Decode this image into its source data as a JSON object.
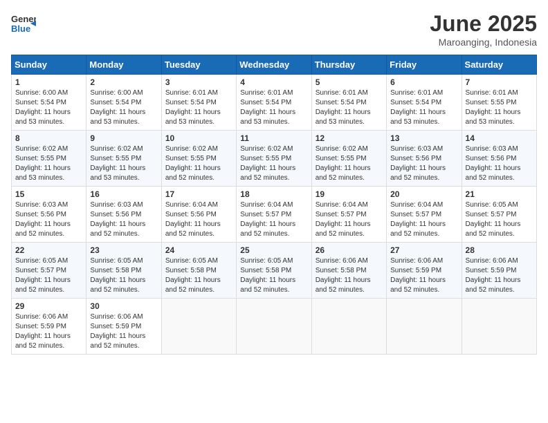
{
  "header": {
    "logo_general": "General",
    "logo_blue": "Blue",
    "title": "June 2025",
    "subtitle": "Maroanging, Indonesia"
  },
  "calendar": {
    "days_of_week": [
      "Sunday",
      "Monday",
      "Tuesday",
      "Wednesday",
      "Thursday",
      "Friday",
      "Saturday"
    ],
    "weeks": [
      [
        null,
        null,
        null,
        null,
        null,
        null,
        null
      ]
    ],
    "cells": [
      {
        "day": 1,
        "sunrise": "6:00 AM",
        "sunset": "5:54 PM",
        "daylight": "11 hours and 53 minutes."
      },
      {
        "day": 2,
        "sunrise": "6:00 AM",
        "sunset": "5:54 PM",
        "daylight": "11 hours and 53 minutes."
      },
      {
        "day": 3,
        "sunrise": "6:01 AM",
        "sunset": "5:54 PM",
        "daylight": "11 hours and 53 minutes."
      },
      {
        "day": 4,
        "sunrise": "6:01 AM",
        "sunset": "5:54 PM",
        "daylight": "11 hours and 53 minutes."
      },
      {
        "day": 5,
        "sunrise": "6:01 AM",
        "sunset": "5:54 PM",
        "daylight": "11 hours and 53 minutes."
      },
      {
        "day": 6,
        "sunrise": "6:01 AM",
        "sunset": "5:54 PM",
        "daylight": "11 hours and 53 minutes."
      },
      {
        "day": 7,
        "sunrise": "6:01 AM",
        "sunset": "5:55 PM",
        "daylight": "11 hours and 53 minutes."
      },
      {
        "day": 8,
        "sunrise": "6:02 AM",
        "sunset": "5:55 PM",
        "daylight": "11 hours and 53 minutes."
      },
      {
        "day": 9,
        "sunrise": "6:02 AM",
        "sunset": "5:55 PM",
        "daylight": "11 hours and 53 minutes."
      },
      {
        "day": 10,
        "sunrise": "6:02 AM",
        "sunset": "5:55 PM",
        "daylight": "11 hours and 52 minutes."
      },
      {
        "day": 11,
        "sunrise": "6:02 AM",
        "sunset": "5:55 PM",
        "daylight": "11 hours and 52 minutes."
      },
      {
        "day": 12,
        "sunrise": "6:02 AM",
        "sunset": "5:55 PM",
        "daylight": "11 hours and 52 minutes."
      },
      {
        "day": 13,
        "sunrise": "6:03 AM",
        "sunset": "5:56 PM",
        "daylight": "11 hours and 52 minutes."
      },
      {
        "day": 14,
        "sunrise": "6:03 AM",
        "sunset": "5:56 PM",
        "daylight": "11 hours and 52 minutes."
      },
      {
        "day": 15,
        "sunrise": "6:03 AM",
        "sunset": "5:56 PM",
        "daylight": "11 hours and 52 minutes."
      },
      {
        "day": 16,
        "sunrise": "6:03 AM",
        "sunset": "5:56 PM",
        "daylight": "11 hours and 52 minutes."
      },
      {
        "day": 17,
        "sunrise": "6:04 AM",
        "sunset": "5:56 PM",
        "daylight": "11 hours and 52 minutes."
      },
      {
        "day": 18,
        "sunrise": "6:04 AM",
        "sunset": "5:57 PM",
        "daylight": "11 hours and 52 minutes."
      },
      {
        "day": 19,
        "sunrise": "6:04 AM",
        "sunset": "5:57 PM",
        "daylight": "11 hours and 52 minutes."
      },
      {
        "day": 20,
        "sunrise": "6:04 AM",
        "sunset": "5:57 PM",
        "daylight": "11 hours and 52 minutes."
      },
      {
        "day": 21,
        "sunrise": "6:05 AM",
        "sunset": "5:57 PM",
        "daylight": "11 hours and 52 minutes."
      },
      {
        "day": 22,
        "sunrise": "6:05 AM",
        "sunset": "5:57 PM",
        "daylight": "11 hours and 52 minutes."
      },
      {
        "day": 23,
        "sunrise": "6:05 AM",
        "sunset": "5:58 PM",
        "daylight": "11 hours and 52 minutes."
      },
      {
        "day": 24,
        "sunrise": "6:05 AM",
        "sunset": "5:58 PM",
        "daylight": "11 hours and 52 minutes."
      },
      {
        "day": 25,
        "sunrise": "6:05 AM",
        "sunset": "5:58 PM",
        "daylight": "11 hours and 52 minutes."
      },
      {
        "day": 26,
        "sunrise": "6:06 AM",
        "sunset": "5:58 PM",
        "daylight": "11 hours and 52 minutes."
      },
      {
        "day": 27,
        "sunrise": "6:06 AM",
        "sunset": "5:59 PM",
        "daylight": "11 hours and 52 minutes."
      },
      {
        "day": 28,
        "sunrise": "6:06 AM",
        "sunset": "5:59 PM",
        "daylight": "11 hours and 52 minutes."
      },
      {
        "day": 29,
        "sunrise": "6:06 AM",
        "sunset": "5:59 PM",
        "daylight": "11 hours and 52 minutes."
      },
      {
        "day": 30,
        "sunrise": "6:06 AM",
        "sunset": "5:59 PM",
        "daylight": "11 hours and 52 minutes."
      }
    ]
  }
}
